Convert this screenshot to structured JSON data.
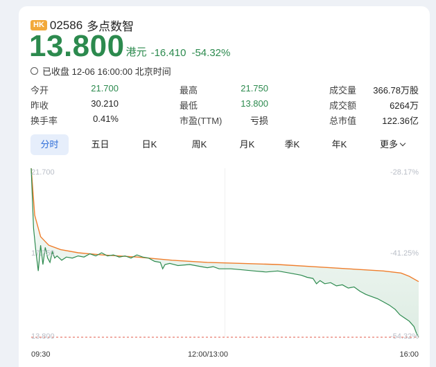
{
  "stock": {
    "market": "HK",
    "code": "02586",
    "name": "多点数智",
    "price": "13.800",
    "currency": "港元",
    "change": "-16.410",
    "change_pct": "-54.32%",
    "status": "已收盘 12-06 16:00:00 北京时间"
  },
  "stats": [
    {
      "label": "今开",
      "value": "21.700",
      "color": "green"
    },
    {
      "label": "最高",
      "value": "21.750",
      "color": "green"
    },
    {
      "label": "成交量",
      "value": "366.78万股",
      "color": "dark"
    },
    {
      "label": "昨收",
      "value": "30.210",
      "color": "dark"
    },
    {
      "label": "最低",
      "value": "13.800",
      "color": "green"
    },
    {
      "label": "成交额",
      "value": "6264万",
      "color": "dark"
    },
    {
      "label": "换手率",
      "value": "0.41%",
      "color": "dark"
    },
    {
      "label": "市盈(TTM)",
      "value": "亏损",
      "color": "dark"
    },
    {
      "label": "总市值",
      "value": "122.36亿",
      "color": "dark"
    }
  ],
  "tabs": [
    {
      "label": "分时",
      "active": true
    },
    {
      "label": "五日"
    },
    {
      "label": "日K"
    },
    {
      "label": "周K"
    },
    {
      "label": "月K"
    },
    {
      "label": "季K"
    },
    {
      "label": "年K"
    },
    {
      "label": "更多"
    }
  ],
  "chart_data": {
    "type": "line",
    "y_left_ticks": [
      "21.700",
      "17.750",
      "13.800"
    ],
    "y_right_ticks": [
      "-28.17%",
      "-41.25%",
      "-54.32%"
    ],
    "x_ticks": [
      "09:30",
      "12:00/13:00",
      "16:00"
    ],
    "ylim": [
      13.8,
      21.7
    ],
    "x_range_minutes": [
      0,
      330
    ],
    "series": [
      {
        "role": "price",
        "color": "#2c8a4e",
        "points": [
          [
            0,
            21.7
          ],
          [
            2,
            18.9
          ],
          [
            4,
            17.8
          ],
          [
            6,
            16.9
          ],
          [
            8,
            18.1
          ],
          [
            10,
            17.2
          ],
          [
            12,
            18.0
          ],
          [
            14,
            17.5
          ],
          [
            16,
            17.3
          ],
          [
            18,
            17.8
          ],
          [
            20,
            17.5
          ],
          [
            22,
            17.6
          ],
          [
            26,
            17.4
          ],
          [
            30,
            17.55
          ],
          [
            35,
            17.5
          ],
          [
            40,
            17.6
          ],
          [
            45,
            17.55
          ],
          [
            50,
            17.7
          ],
          [
            55,
            17.6
          ],
          [
            60,
            17.75
          ],
          [
            65,
            17.6
          ],
          [
            70,
            17.65
          ],
          [
            75,
            17.55
          ],
          [
            80,
            17.6
          ],
          [
            85,
            17.5
          ],
          [
            90,
            17.65
          ],
          [
            95,
            17.55
          ],
          [
            100,
            17.5
          ],
          [
            105,
            17.35
          ],
          [
            110,
            17.3
          ],
          [
            112,
            17.0
          ],
          [
            114,
            17.2
          ],
          [
            118,
            17.25
          ],
          [
            125,
            17.15
          ],
          [
            135,
            17.2
          ],
          [
            145,
            17.1
          ],
          [
            150,
            17.05
          ],
          [
            155,
            17.1
          ],
          [
            160,
            17.0
          ],
          [
            170,
            17.0
          ],
          [
            180,
            16.95
          ],
          [
            190,
            16.9
          ],
          [
            200,
            16.85
          ],
          [
            210,
            16.9
          ],
          [
            220,
            16.8
          ],
          [
            230,
            16.7
          ],
          [
            235,
            16.6
          ],
          [
            240,
            16.55
          ],
          [
            243,
            16.3
          ],
          [
            246,
            16.45
          ],
          [
            250,
            16.3
          ],
          [
            255,
            16.35
          ],
          [
            260,
            16.2
          ],
          [
            265,
            16.25
          ],
          [
            270,
            16.1
          ],
          [
            275,
            16.15
          ],
          [
            280,
            15.95
          ],
          [
            285,
            15.8
          ],
          [
            290,
            15.7
          ],
          [
            295,
            15.6
          ],
          [
            300,
            15.45
          ],
          [
            305,
            15.3
          ],
          [
            310,
            15.1
          ],
          [
            314,
            14.85
          ],
          [
            318,
            14.7
          ],
          [
            322,
            14.55
          ],
          [
            326,
            14.3
          ],
          [
            328,
            14.0
          ],
          [
            330,
            13.8
          ]
        ]
      },
      {
        "role": "average",
        "color": "#ef7d2b",
        "points": [
          [
            0,
            21.7
          ],
          [
            3,
            19.5
          ],
          [
            8,
            18.5
          ],
          [
            15,
            18.1
          ],
          [
            25,
            17.9
          ],
          [
            40,
            17.75
          ],
          [
            60,
            17.65
          ],
          [
            90,
            17.55
          ],
          [
            120,
            17.4
          ],
          [
            150,
            17.3
          ],
          [
            180,
            17.25
          ],
          [
            210,
            17.2
          ],
          [
            240,
            17.1
          ],
          [
            270,
            17.0
          ],
          [
            300,
            16.9
          ],
          [
            315,
            16.8
          ],
          [
            322,
            16.65
          ],
          [
            330,
            16.4
          ]
        ]
      }
    ]
  }
}
